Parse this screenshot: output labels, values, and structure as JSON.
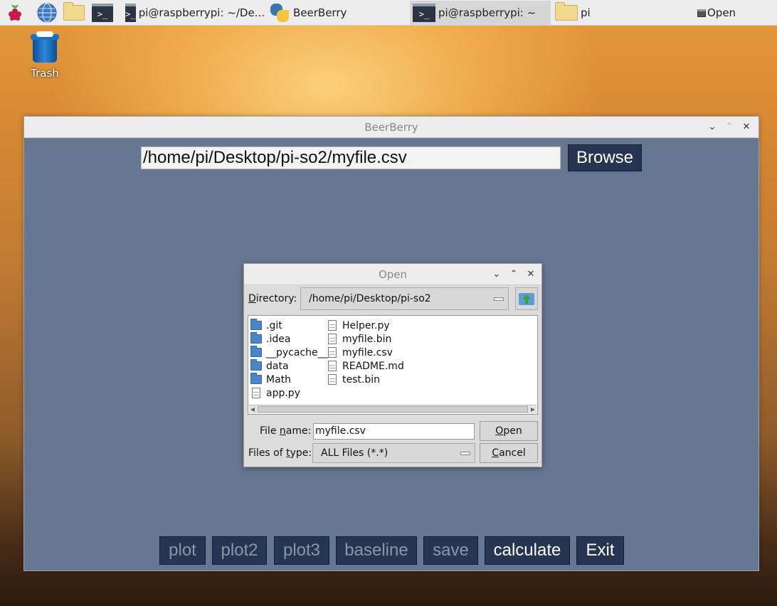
{
  "taskbar": {
    "tasks": [
      {
        "label": "pi@raspberrypi: ~/De..."
      },
      {
        "label": "BeerBerry"
      },
      {
        "label": "pi@raspberrypi: ~"
      },
      {
        "label": "pi"
      },
      {
        "label": "Open"
      }
    ]
  },
  "desktop": {
    "trash_label": "Trash"
  },
  "main_window": {
    "title": "BeerBerry",
    "file_path": "/home/pi/Desktop/pi-so2/myfile.csv",
    "browse_label": "Browse",
    "buttons": [
      {
        "label": "plot"
      },
      {
        "label": "plot2"
      },
      {
        "label": "plot3"
      },
      {
        "label": "baseline"
      },
      {
        "label": "save"
      },
      {
        "label": "calculate"
      },
      {
        "label": "Exit"
      }
    ]
  },
  "open_dialog": {
    "title": "Open",
    "directory_label_first": "D",
    "directory_label_rest": "irectory:",
    "directory_value": "/home/pi/Desktop/pi-so2",
    "files_col1": [
      {
        "name": ".git",
        "type": "folder"
      },
      {
        "name": ".idea",
        "type": "folder"
      },
      {
        "name": "__pycache__",
        "type": "folder"
      },
      {
        "name": "data",
        "type": "folder"
      },
      {
        "name": "Math",
        "type": "folder"
      },
      {
        "name": "app.py",
        "type": "file"
      }
    ],
    "files_col2": [
      {
        "name": "Helper.py",
        "type": "file"
      },
      {
        "name": "myfile.bin",
        "type": "file"
      },
      {
        "name": "myfile.csv",
        "type": "file"
      },
      {
        "name": "README.md",
        "type": "file"
      },
      {
        "name": "test.bin",
        "type": "file"
      }
    ],
    "filename_label_a": "File ",
    "filename_label_u": "n",
    "filename_label_b": "ame:",
    "filename_value": "myfile.csv",
    "filetype_label_a": "Files of ",
    "filetype_label_u": "t",
    "filetype_label_b": "ype:",
    "filetype_value": "ALL Files (*.*)",
    "open_label_u": "O",
    "open_label_rest": "pen",
    "cancel_label_u": "C",
    "cancel_label_rest": "ancel"
  }
}
